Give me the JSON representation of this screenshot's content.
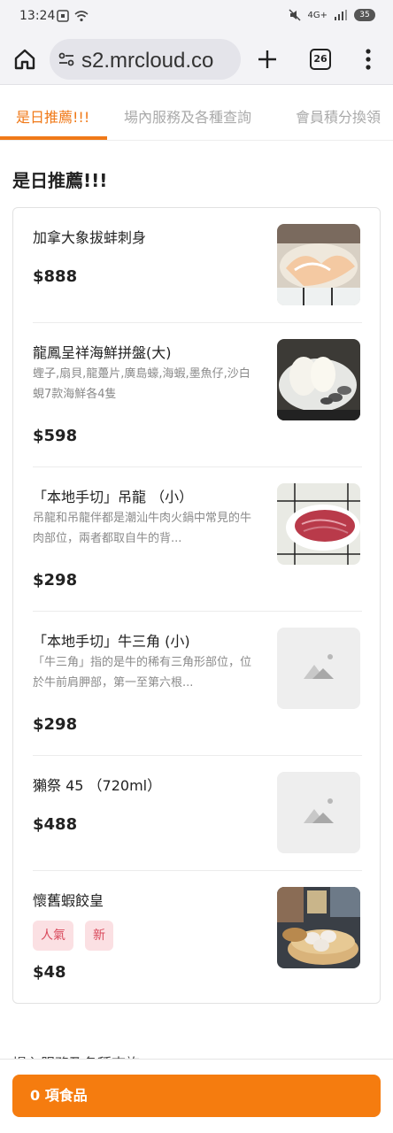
{
  "status_bar": {
    "time": "13:24",
    "network": "4G+",
    "battery": "35"
  },
  "browser": {
    "url": "s2.mrcloud.co",
    "tab_count": "26"
  },
  "category_tabs": [
    {
      "label": "是日推薦!!!",
      "active": true
    },
    {
      "label": "場內服務及各種查詢",
      "active": false
    },
    {
      "label": "會員積分換領",
      "active": false
    }
  ],
  "section": {
    "title": "是日推薦!!!"
  },
  "items": [
    {
      "name": "加拿大象拔蚌刺身",
      "description": "",
      "price": "$888",
      "image": "geoduck-sashimi-photo"
    },
    {
      "name": "龍鳳呈祥海鮮拼盤(大)",
      "description": "蟶子,扇貝,龍躉片,廣島蠔,海蝦,墨魚仔,沙白蜆7款海鮮各4隻",
      "price": "$598",
      "image": "seafood-platter-photo"
    },
    {
      "name": "「本地手切」吊龍 （小）",
      "description": "吊龍和吊龍伴都是潮汕牛肉火鍋中常見的牛肉部位，兩者都取自牛的背...",
      "price": "$298",
      "image": "beef-slices-photo"
    },
    {
      "name": "「本地手切」牛三角 (小)",
      "description": "「牛三角」指的是牛的稀有三角形部位，位於牛前肩胛部，第一至第六根...",
      "price": "$298",
      "image": "image-placeholder-icon"
    },
    {
      "name": "獺祭 45 （720ml）",
      "description": "",
      "price": "$488",
      "image": "image-placeholder-icon"
    },
    {
      "name": "懷舊蝦餃皇",
      "description": "",
      "price": "$48",
      "image": "shrimp-dumpling-photo",
      "tags": [
        "人氣",
        "新"
      ]
    }
  ],
  "next_section_peek": "場內服務及各種查詢",
  "cart": {
    "label": "0 項食品"
  },
  "colors": {
    "accent": "#f07918",
    "cart_button": "#f57c0f",
    "tag_bg": "#fbe0e3",
    "tag_text": "#d94a5c"
  }
}
